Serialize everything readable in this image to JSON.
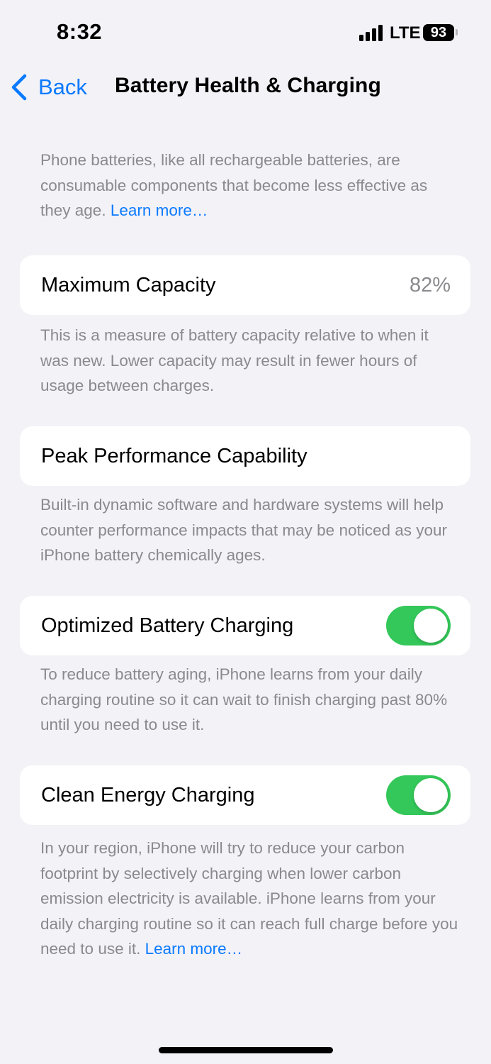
{
  "status_bar": {
    "time": "8:32",
    "network": "LTE",
    "battery_level": "93"
  },
  "nav": {
    "back_label": "Back",
    "title": "Battery Health & Charging"
  },
  "intro": {
    "text": "Phone batteries, like all rechargeable batteries, are consumable components that become less effective as they age.",
    "link": "Learn more…"
  },
  "maximum_capacity": {
    "label": "Maximum Capacity",
    "value": "82%",
    "footnote": "This is a measure of battery capacity relative to when it was new. Lower capacity may result in fewer hours of usage between charges."
  },
  "peak_performance": {
    "label": "Peak Performance Capability",
    "footnote": "Built-in dynamic software and hardware systems will help counter performance impacts that may be noticed as your iPhone battery chemically ages."
  },
  "optimized_charging": {
    "label": "Optimized Battery Charging",
    "enabled": true,
    "footnote": "To reduce battery aging, iPhone learns from your daily charging routine so it can wait to finish charging past 80% until you need to use it."
  },
  "clean_energy": {
    "label": "Clean Energy Charging",
    "enabled": true,
    "footnote": "In your region, iPhone will try to reduce your carbon footprint by selectively charging when lower carbon emission electricity is available. iPhone learns from your daily charging routine so it can reach full charge before you need to use it.",
    "link": "Learn more…"
  },
  "colors": {
    "accent": "#0a7aff",
    "toggle_on": "#34c759",
    "background": "#f2f2f7",
    "secondary_text": "#8a8a8e"
  }
}
